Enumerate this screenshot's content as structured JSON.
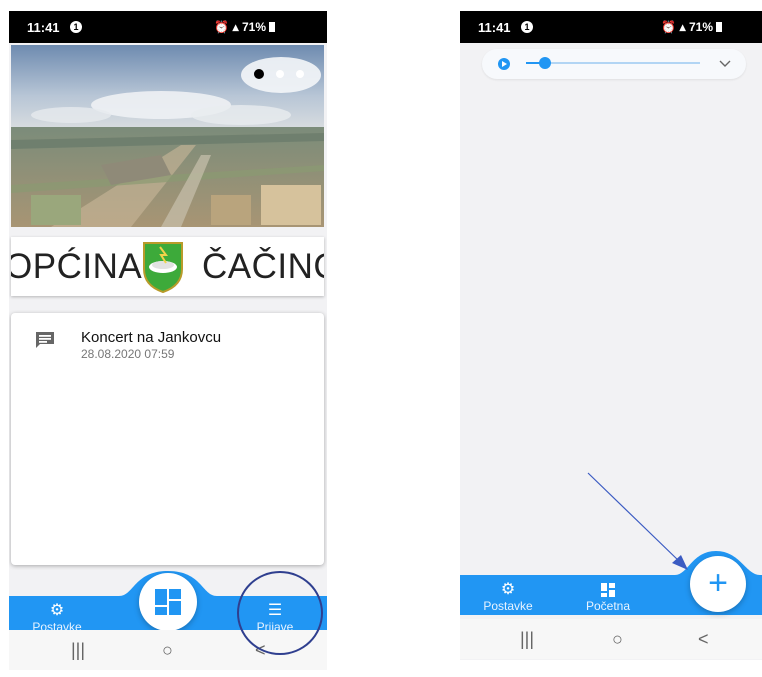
{
  "left_screen": {
    "status": {
      "time": "11:41",
      "notification_badge": "1",
      "signal_text": "71%"
    },
    "logo": {
      "left_text": "OPĆINA",
      "right_text": "ČAČINCI"
    },
    "notification": {
      "title": "Koncert na Jankovcu",
      "date": "28.08.2020 07:59",
      "icon": "message-icon"
    },
    "bottom_nav": {
      "settings_label": "Postavke",
      "prijave_label": "Prijave",
      "center_icon": "dashboard-icon"
    },
    "system_nav": {
      "recent": "|||",
      "home": "○",
      "back": "<"
    }
  },
  "right_screen": {
    "status": {
      "time": "11:41",
      "notification_badge": "1",
      "signal_text": "71%"
    },
    "player": {
      "progress_fraction": 0.1
    },
    "bottom_nav": {
      "settings_label": "Postavke",
      "home_label": "Početna",
      "fab_icon": "+"
    },
    "system_nav": {
      "recent": "|||",
      "home": "○",
      "back": "<"
    }
  },
  "colors": {
    "accent": "#2196f3",
    "annotation": "#2f3f8f",
    "shield_green": "#3daa3a"
  }
}
